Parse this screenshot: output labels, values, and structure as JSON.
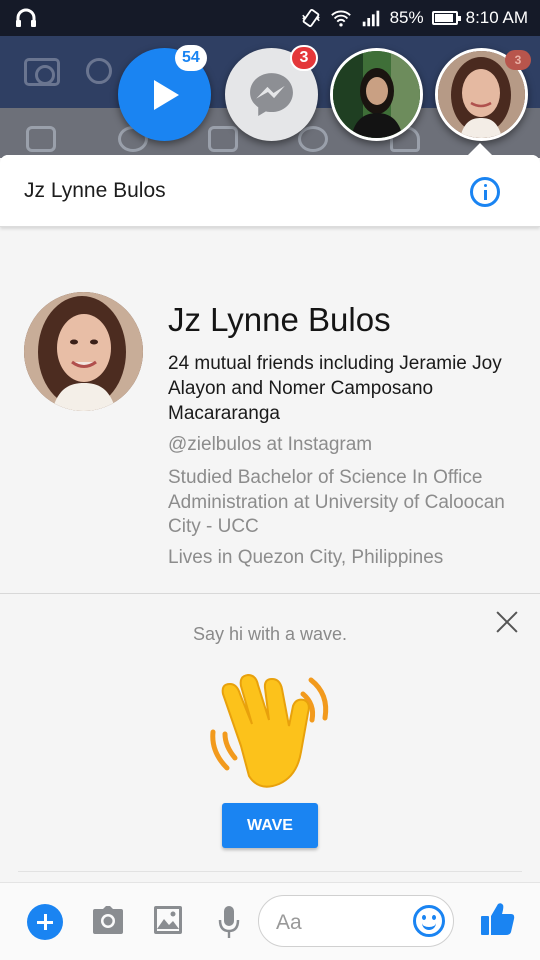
{
  "status_bar": {
    "battery": "85%",
    "battery_level": 0.85,
    "time": "8:10 AM",
    "icons": [
      "headphones-icon",
      "vibrate-icon",
      "wifi-icon",
      "signal-icon",
      "battery-icon"
    ]
  },
  "chat_heads": {
    "video_badge": "54",
    "messenger_badge": "3",
    "faint_badge": "3"
  },
  "header": {
    "title": "Jz Lynne Bulos"
  },
  "profile": {
    "name": "Jz Lynne Bulos",
    "mutual": "24 mutual friends including Jeramie Joy Alayon and Nomer Camposano Macararanga",
    "instagram": "@zielbulos at Instagram",
    "studied": "Studied Bachelor of Science In Office Administration at University of Caloocan City - UCC",
    "lives": "Lives in Quezon City, Philippines"
  },
  "wave": {
    "prompt": "Say hi with a wave.",
    "button": "WAVE"
  },
  "composer": {
    "placeholder": "Aa",
    "icons": [
      "add-icon",
      "camera-icon",
      "gallery-icon",
      "microphone-icon",
      "emoji-icon",
      "like-icon"
    ]
  },
  "colors": {
    "accent": "#1a84f2",
    "badge_red": "#e4373a",
    "status_bar": "#151a28"
  }
}
